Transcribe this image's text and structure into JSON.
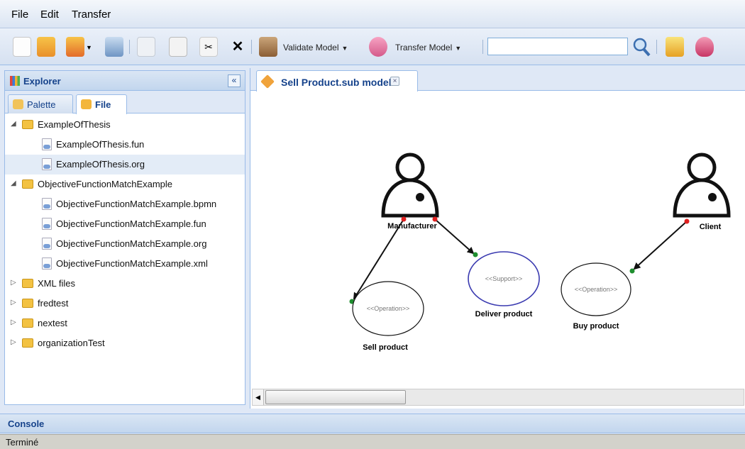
{
  "menu": {
    "file": "File",
    "edit": "Edit",
    "transfer": "Transfer"
  },
  "toolbar": {
    "validate_label": "Validate Model",
    "transfer_label": "Transfer Model",
    "search_value": "",
    "icons": [
      "new-file-icon",
      "palette-icon",
      "heart-icon",
      "print-icon",
      "copy-icon",
      "paste-icon",
      "cut-icon",
      "delete-icon",
      "validate-icon",
      "transfer-icon",
      "search-icon",
      "export-icon",
      "love-icon"
    ]
  },
  "explorer": {
    "title": "Explorer",
    "collapse": "«",
    "tabs": [
      {
        "label": "Palette"
      },
      {
        "label": "File"
      }
    ],
    "tree": [
      {
        "label": "ExampleOfThesis",
        "type": "folder",
        "expanded": true
      },
      {
        "label": "ExampleOfThesis.fun",
        "type": "file"
      },
      {
        "label": "ExampleOfThesis.org",
        "type": "file",
        "selected": true
      },
      {
        "label": "ObjectiveFunctionMatchExample",
        "type": "folder",
        "expanded": true
      },
      {
        "label": "ObjectiveFunctionMatchExample.bpmn",
        "type": "file"
      },
      {
        "label": "ObjectiveFunctionMatchExample.fun",
        "type": "file"
      },
      {
        "label": "ObjectiveFunctionMatchExample.org",
        "type": "file"
      },
      {
        "label": "ObjectiveFunctionMatchExample.xml",
        "type": "file"
      },
      {
        "label": "XML files",
        "type": "folder",
        "expanded": false
      },
      {
        "label": "fredtest",
        "type": "folder",
        "expanded": false
      },
      {
        "label": "nextest",
        "type": "folder",
        "expanded": false
      },
      {
        "label": "organizationTest",
        "type": "folder",
        "expanded": false
      }
    ]
  },
  "editor": {
    "tab_title": "Sell Product.sub model",
    "tab_close": "×",
    "diagram": {
      "actors": {
        "manufacturer": "Manufacturer",
        "client": "Client"
      },
      "stereotypes": {
        "operation": "<<Operation>>",
        "support": "<<Support>>"
      },
      "nodes": {
        "sell": "Sell product",
        "deliver": "Deliver product",
        "buy": "Buy product"
      }
    }
  },
  "console": {
    "title": "Console"
  },
  "status": {
    "text": "Terminé"
  }
}
